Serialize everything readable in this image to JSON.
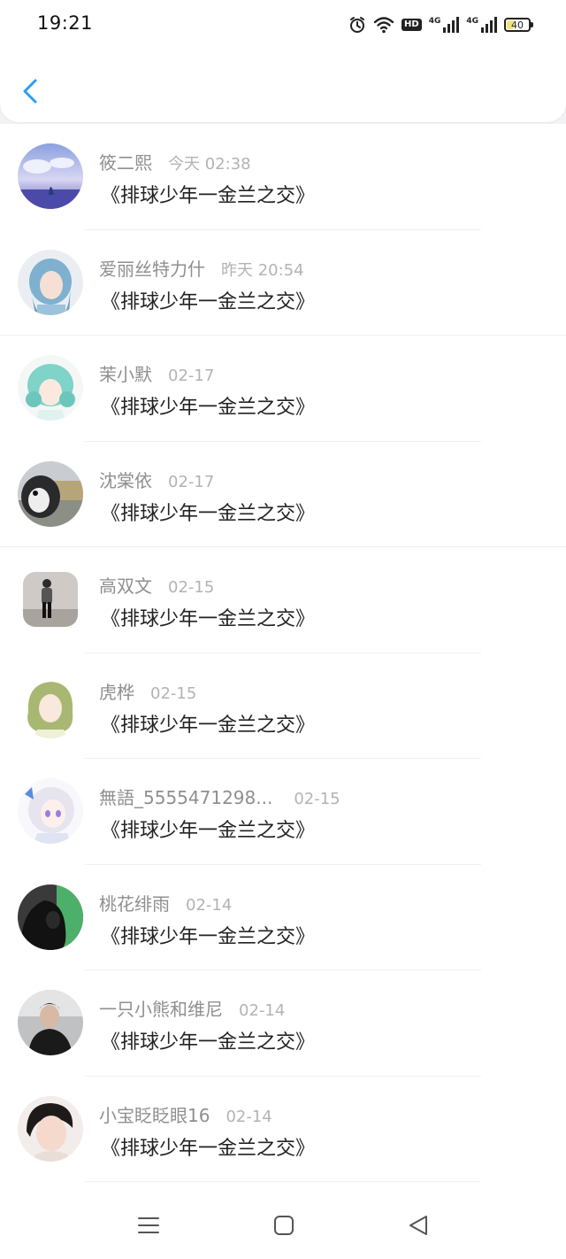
{
  "status_bar": {
    "time": "19:21",
    "network_1": "4G",
    "network_2": "4G",
    "hd_label": "HD",
    "battery_level": "40",
    "battery_fraction": 0.4
  },
  "colors": {
    "accent": "#2a9df4",
    "name_text": "#8f8f8f",
    "time_text": "#b3b3b3",
    "message_text": "#222222"
  },
  "conversations": [
    {
      "name": "筱二熙",
      "time": "今天 02:38",
      "message": "《排球少年一金兰之交》"
    },
    {
      "name": "爱丽丝特力什",
      "time": "昨天 20:54",
      "message": "《排球少年一金兰之交》"
    },
    {
      "name": "茉小默",
      "time": "02-17",
      "message": "《排球少年一金兰之交》"
    },
    {
      "name": "沈棠依",
      "time": "02-17",
      "message": "《排球少年一金兰之交》"
    },
    {
      "name": "高双文",
      "time": "02-15",
      "message": "《排球少年一金兰之交》"
    },
    {
      "name": "虎桦",
      "time": "02-15",
      "message": "《排球少年一金兰之交》"
    },
    {
      "name": "無語_5555471298...",
      "time": "02-15",
      "message": "《排球少年一金兰之交》"
    },
    {
      "name": "桃花绯雨",
      "time": "02-14",
      "message": "《排球少年一金兰之交》"
    },
    {
      "name": "一只小熊和维尼",
      "time": "02-14",
      "message": "《排球少年一金兰之交》"
    },
    {
      "name": "小宝眨眨眼16",
      "time": "02-14",
      "message": "《排球少年一金兰之交》"
    }
  ],
  "icons": {
    "back": "chevron-left-icon",
    "nav_menu": "menu-icon",
    "nav_home": "home-square-icon",
    "nav_back": "back-triangle-icon"
  }
}
